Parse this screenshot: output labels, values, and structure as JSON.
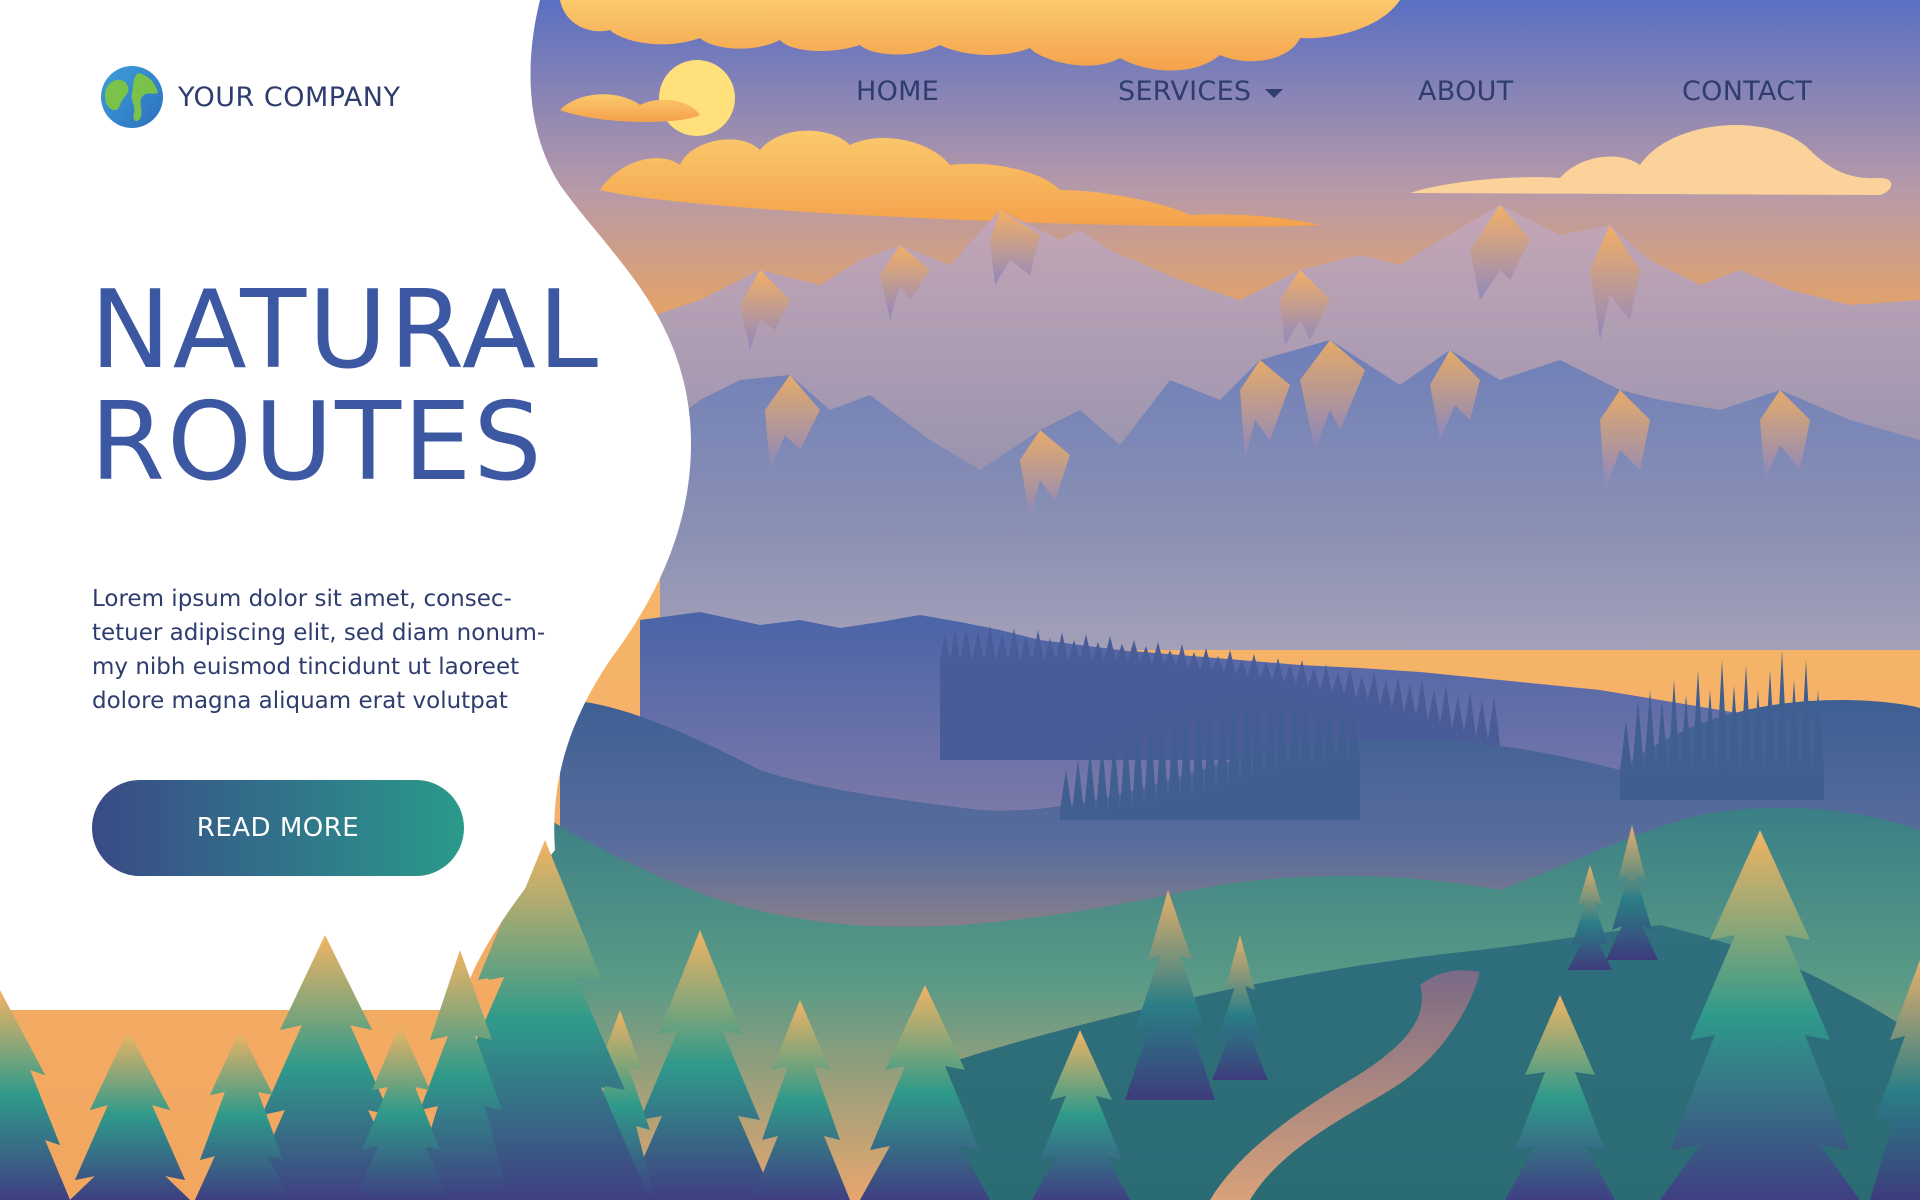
{
  "brand": {
    "name": "YOUR COMPANY",
    "logo_icon": "globe-icon"
  },
  "nav": {
    "items": [
      {
        "label": "HOME"
      },
      {
        "label": "SERVICES",
        "has_dropdown": true
      },
      {
        "label": "ABOUT"
      },
      {
        "label": "CONTACT"
      }
    ]
  },
  "hero": {
    "title_line1": "NATURAL",
    "title_line2": "ROUTES",
    "body_lines": [
      "Lorem ipsum dolor sit amet, consec-",
      "tetuer adipiscing elit, sed diam nonum-",
      "my nibh euismod tincidunt ut laoreet",
      "dolore magna aliquam erat volutpat"
    ],
    "cta_label": "READ MORE"
  },
  "colors": {
    "heading": "#3d58a2",
    "text": "#2f3d6e",
    "sky_top": "#5a6fc2",
    "sky_bottom": "#f4a64f",
    "cta_start": "#3a4a86",
    "cta_end": "#2a9a8a"
  }
}
